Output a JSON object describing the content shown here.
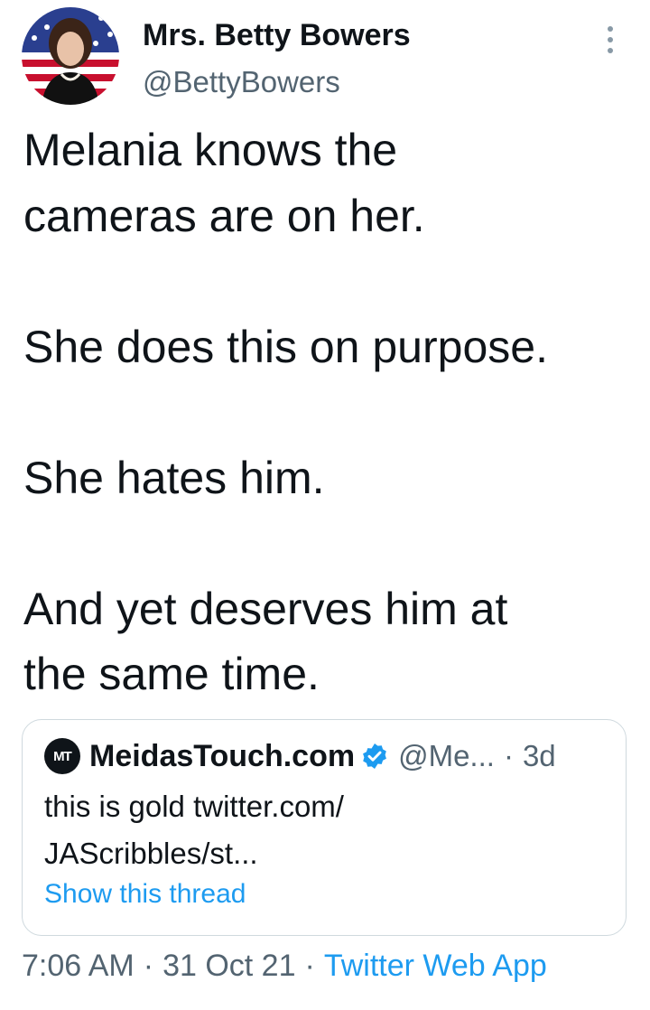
{
  "author": {
    "display_name": "Mrs. Betty Bowers",
    "handle": "@BettyBowers",
    "avatar_icon": "profile-photo-icon"
  },
  "tweet": {
    "text": "Melania knows the\ncameras are on her.\n\nShe does this on purpose.\n\nShe hates him.\n\nAnd yet deserves him at\nthe same time."
  },
  "quoted_tweet": {
    "avatar_label": "MT",
    "display_name": "MeidasTouch.com",
    "verified_icon": "verified-badge-icon",
    "handle": "@Me...",
    "separator": "·",
    "time": "3d",
    "text": "this is gold twitter.com/\nJAScribbles/st...",
    "show_thread": "Show this thread"
  },
  "meta": {
    "time": "7:06 AM",
    "date": "31 Oct 21",
    "separator": "·",
    "source": "Twitter Web App"
  },
  "colors": {
    "link": "#1d9bf0",
    "secondary_text": "#536471",
    "border": "#cfd9de"
  }
}
